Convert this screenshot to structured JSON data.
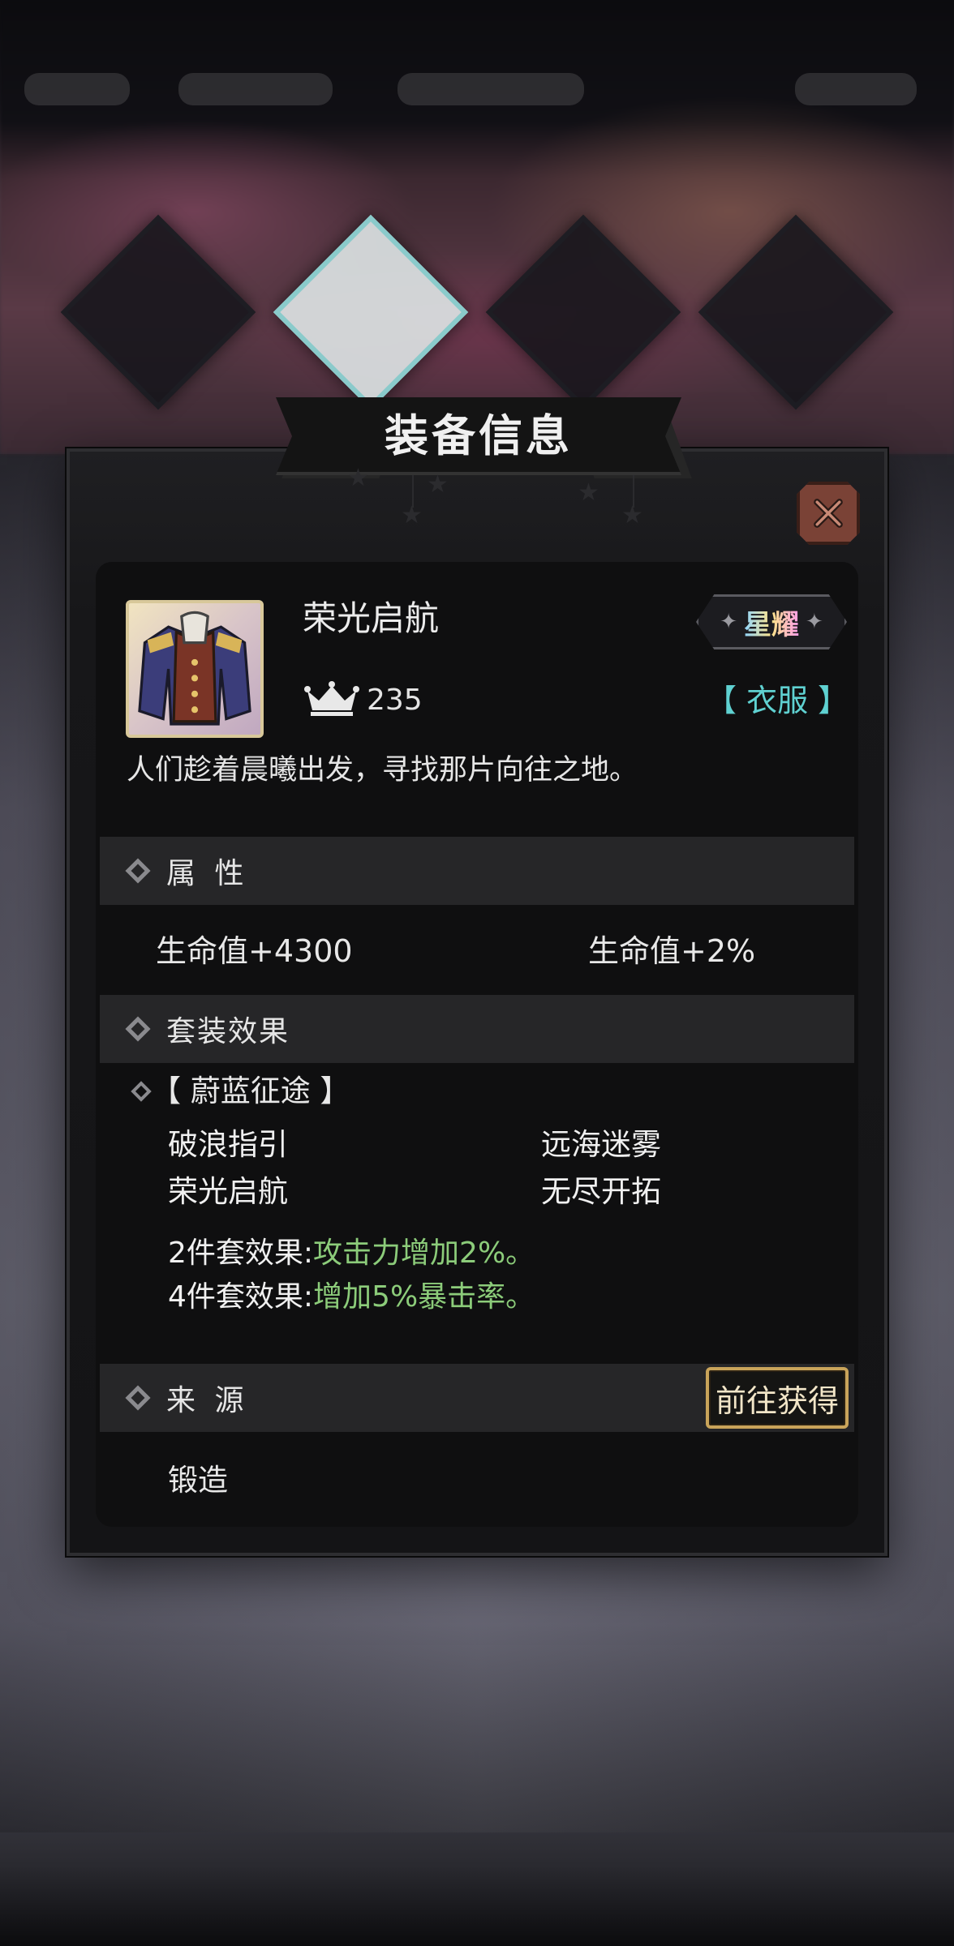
{
  "dialog": {
    "title": "装备信息"
  },
  "item": {
    "name": "荣光启航",
    "rarity": "星耀",
    "power": "235",
    "type": "【 衣服 】",
    "description": "人们趁着晨曦出发，寻找那片向往之地。",
    "icon": "jacket-icon"
  },
  "attributes": {
    "header": "属 性",
    "values": [
      "生命值+4300",
      "生命值+2%"
    ]
  },
  "set_effect": {
    "header": "套装效果",
    "set_name": "【 蔚蓝征途 】",
    "pieces": [
      "破浪指引",
      "远海迷雾",
      "荣光启航",
      "无尽开拓"
    ],
    "bonuses": [
      {
        "label": "2件套效果:",
        "effect": "攻击力增加2%。"
      },
      {
        "label": "4件套效果:",
        "effect": "增加5%暴击率。"
      }
    ]
  },
  "source": {
    "header": "来 源",
    "goto_button": "前往获得",
    "value": "锻造"
  },
  "colors": {
    "accent_cyan": "#5fd1d1",
    "effect_green": "#8ccc7a",
    "button_gold": "#c9a45a",
    "close_red": "#7a4236"
  }
}
